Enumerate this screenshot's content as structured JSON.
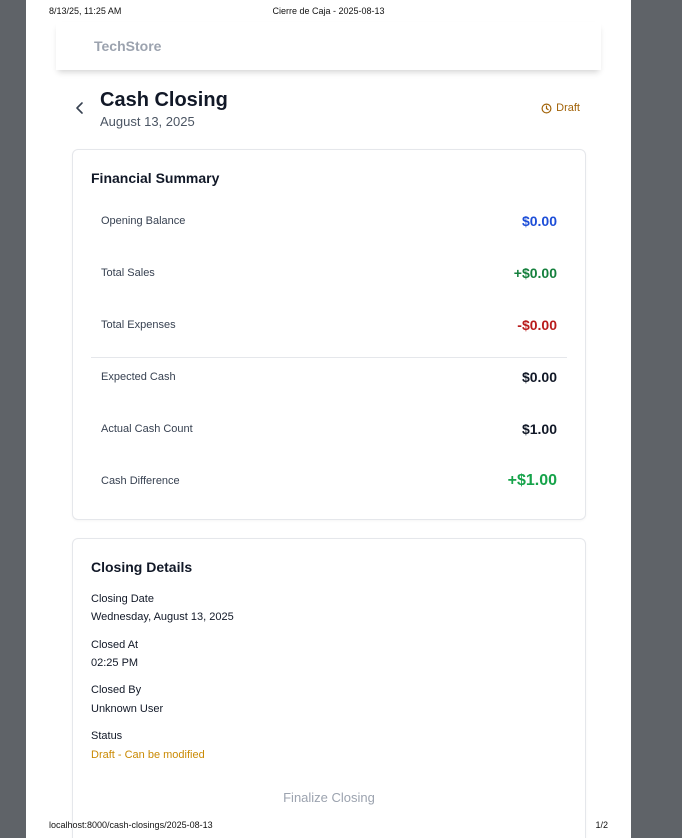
{
  "print_header": {
    "datetime": "8/13/25, 11:25 AM",
    "doc_title": "Cierre de Caja - 2025-08-13"
  },
  "navbar": {
    "brand": "TechStore"
  },
  "header": {
    "title": "Cash Closing",
    "date": "August 13, 2025",
    "status": "Draft",
    "back_icon": "chevron-left-icon",
    "status_icon": "clock-icon"
  },
  "summary": {
    "title": "Financial Summary",
    "rows": [
      {
        "label": "Opening Balance",
        "value": "$0.00",
        "color": "#1d4ed8"
      },
      {
        "label": "Total Sales",
        "value": "+$0.00",
        "color": "#15803d"
      },
      {
        "label": "Total Expenses",
        "value": "-$0.00",
        "color": "#b91c1c"
      },
      {
        "label": "Expected Cash",
        "value": "$0.00",
        "color": "#111827"
      },
      {
        "label": "Actual Cash Count",
        "value": "$1.00",
        "color": "#111827"
      },
      {
        "label": "Cash Difference",
        "value": "+$1.00",
        "color": "#16a34a"
      }
    ]
  },
  "details": {
    "title": "Closing Details",
    "closing_date_label": "Closing Date",
    "closing_date_value": "Wednesday, August 13, 2025",
    "closed_at_label": "Closed At",
    "closed_at_value": "02:25 PM",
    "closed_by_label": "Closed By",
    "closed_by_value": "Unknown User",
    "status_label": "Status",
    "status_value": "Draft - Can be modified",
    "status_color": "#ca8a04",
    "finalize_label": "Finalize Closing"
  },
  "print_footer": {
    "url": "localhost:8000/cash-closings/2025-08-13",
    "page": "1/2"
  }
}
